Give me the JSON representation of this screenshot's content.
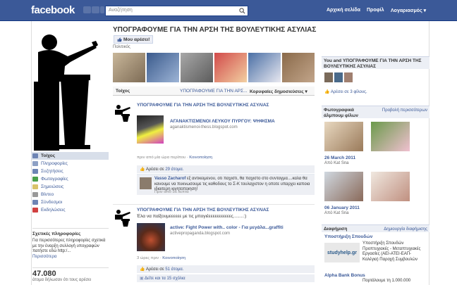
{
  "topbar": {
    "logo": "facebook",
    "search_placeholder": "Αναζήτηση",
    "nav": [
      "Αρχική σελίδα",
      "Προφίλ",
      "Λογαριασμός ▾"
    ]
  },
  "page": {
    "title": "ΥΠΟΓΡΑΦΟΥΜΕ ΓΙΑ ΤΗΝ ΑΡΣΗ ΤΗΣ ΒΟΥΛΕΥΤΙΚΗΣ ΑΣΥΛΙΑΣ",
    "like_button": "Μου αρέσει!",
    "category": "Πολιτικός"
  },
  "leftnav": [
    {
      "label": "Τοίχος",
      "icon": "wall-icon",
      "active": true,
      "color": "#6d84b4"
    },
    {
      "label": "Πληροφορίες",
      "icon": "info-icon",
      "active": false,
      "color": "#8da0c4"
    },
    {
      "label": "Συζητήσεις",
      "icon": "discussion-icon",
      "active": false,
      "color": "#6d84b4"
    },
    {
      "label": "Φωτογραφίες",
      "icon": "photos-icon",
      "active": false,
      "color": "#4aa04a"
    },
    {
      "label": "Σημειώσεις",
      "icon": "notes-icon",
      "active": false,
      "color": "#d8c36a"
    },
    {
      "label": "Βίντεο",
      "icon": "video-icon",
      "active": false,
      "color": "#999999"
    },
    {
      "label": "Σύνδεσμοι",
      "icon": "links-icon",
      "active": false,
      "color": "#6d84b4"
    },
    {
      "label": "Εκδηλώσεις",
      "icon": "events-icon",
      "active": false,
      "color": "#d04040"
    }
  ],
  "about": {
    "heading": "Σχετικές πληροφορίες",
    "text": "Για περισσότερες πληροφορίες σχετικά με την έναρξη συλλογή υπογραφών πατήστε εδώ http:/...",
    "more": "Περισσότερα"
  },
  "likes": {
    "count": "47.080",
    "caption": "άτομα δήλωσαν ότι τους αρέσει"
  },
  "tabs": {
    "wall": "Τοίχος",
    "page_filter": "ΥΠΟΓΡΑΦΟΥΜΕ ΓΙΑ ΤΗΝ ΑΡΣ...",
    "top_posts": "Κορυφαίες δημοσιεύσεις ▾"
  },
  "posts": [
    {
      "author": "ΥΠΟΓΡΑΦΟΥΜΕ ΓΙΑ ΤΗΝ ΑΡΣΗ ΤΗΣ ΒΟΥΛΕΥΤΙΚΗΣ ΑΣΥΛΙΑΣ",
      "message": "",
      "link_title": "ΑΓΑΝΑΚΤΙΣΜΕΝΟΙ ΛΕΥΚΟΥ ΠΥΡΓΟΥ: ΨΗΦΙΣΜΑ",
      "link_url": "aganaktismenoi-thess.blogspot.com",
      "meta_time": "πριν από μία ώρα περίπου",
      "meta_action": "Κοινοποίηση",
      "likes_text": "Αρέσει σε ",
      "likes_link": "29 άτομα.",
      "comment": {
        "name": "Vasso Zacharof",
        "text": "εξ αντικειμενου, οτι παχιστι, θα παχιστο στο συνταγμα....καλα θα κανουμε να πυκνωσουμε τις καθοδους το Σ-Κ τουλαχιστον η οποτε υπαρχει καποια ιδιαιτερη κινητοποιηση!",
        "time": "Πριν από 56 λεπτά"
      }
    },
    {
      "author": "ΥΠΟΓΡΑΦΟΥΜΕ ΓΙΑ ΤΗΝ ΑΡΣΗ ΤΗΣ ΒΟΥΛΕΥΤΙΚΗΣ ΑΣΥΛΙΑΣ",
      "message": "Έλα να παίξουμεεεεεε με τις μπογιέεεεεεεεεεεες........:)",
      "link_title": "active: Fight Power with.. color - Για μεγάλα...graffiti",
      "link_url": "activepropaganda.blogspot.com",
      "meta_time": "3 ώρες πριν",
      "meta_action": "Κοινοποίηση",
      "likes_text": "Αρέσει σε ",
      "likes_link": "51 άτομα.",
      "comments_link": "Δείτε και τα 15 σχόλια"
    }
  ],
  "right": {
    "friends_head": "You and ΥΠΟΓΡΑΦΟΥΜΕ ΓΙΑ ΤΗΝ ΑΡΣΗ ΤΗΣ ΒΟΥΛΕΥΤΙΚΗΣ ΑΣΥΛΙΑΣ",
    "friends_note": "Αρέσει σε 3 φίλους.",
    "albums_head": "Φωτογραφικά άλμπουμ φίλων",
    "albums_more": "Προβολή περισσότερων",
    "albums": [
      {
        "date": "26 March 2011",
        "by": "Από Kat Sna"
      },
      {
        "date": "06 January 2011",
        "by": "Από Kat Sna"
      }
    ],
    "ads_head": "Διαφήμιση",
    "ads_more": "Δημιουργία διαφήμισης",
    "ad1_title": "Υποστήριξη Σπουδών",
    "ad1_logo": "studyhelp.gr",
    "ad1_text": "Υποστήριξη Σπουδών Προπτυχιακές - Μεταπτυχιακές Εργασίες (ΑΕΙ-ΑΤΕΙ-ΕΑΠ-Κολέγια) Παροχή Συμβουλών",
    "ad2_title": "Alpha Bank Bonus",
    "ad2_text": "Πορτάλουμε τη 1.000.000"
  }
}
